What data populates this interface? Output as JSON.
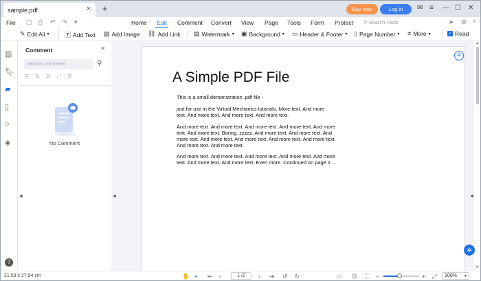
{
  "titlebar": {
    "tab_title": "sample.pdf",
    "buy_label": "Buy now",
    "login_label": "Log in"
  },
  "menubar": {
    "file_label": "File",
    "items": [
      "Home",
      "Edit",
      "Comment",
      "Convert",
      "View",
      "Page",
      "Tools",
      "Form",
      "Protect"
    ],
    "active": "Edit",
    "search_placeholder": "Search Tools"
  },
  "toolbar": {
    "edit_all": "Edit All",
    "add_text": "Add Text",
    "add_image": "Add Image",
    "add_link": "Add Link",
    "watermark": "Watermark",
    "background": "Background",
    "header_footer": "Header & Footer",
    "page_number": "Page Number",
    "more": "More",
    "read": "Read"
  },
  "comment_panel": {
    "title": "Comment",
    "search_placeholder": "Search comments",
    "empty_text": "No Comment"
  },
  "document": {
    "heading": "A Simple PDF File",
    "lines": [
      "This is a small demonstration .pdf file -",
      "just for use in the Virtual Mechanics tutorials. More text. And more",
      "text. And more text. And more text. And more text.",
      "And more text. And more text. And more text. And more text. And more",
      "text. And more text. Boring, zzzzz. And more text. And more text. And",
      "more text. And more text. And more text. And more text. And more text.",
      "And more text. And more text.",
      "And more text. And more text. And more text. And more text. And more",
      "text. And more text. And more text. Even more. Continued on page 2 ..."
    ]
  },
  "statusbar": {
    "page_size": "21.59 x 27.94 cm",
    "page_indicator": "1 /2",
    "zoom": "100%",
    "zoom_fraction": 0.45
  },
  "colors": {
    "accent": "#1f6fe5",
    "buy": "#f6944a",
    "login": "#3a7ef0"
  }
}
